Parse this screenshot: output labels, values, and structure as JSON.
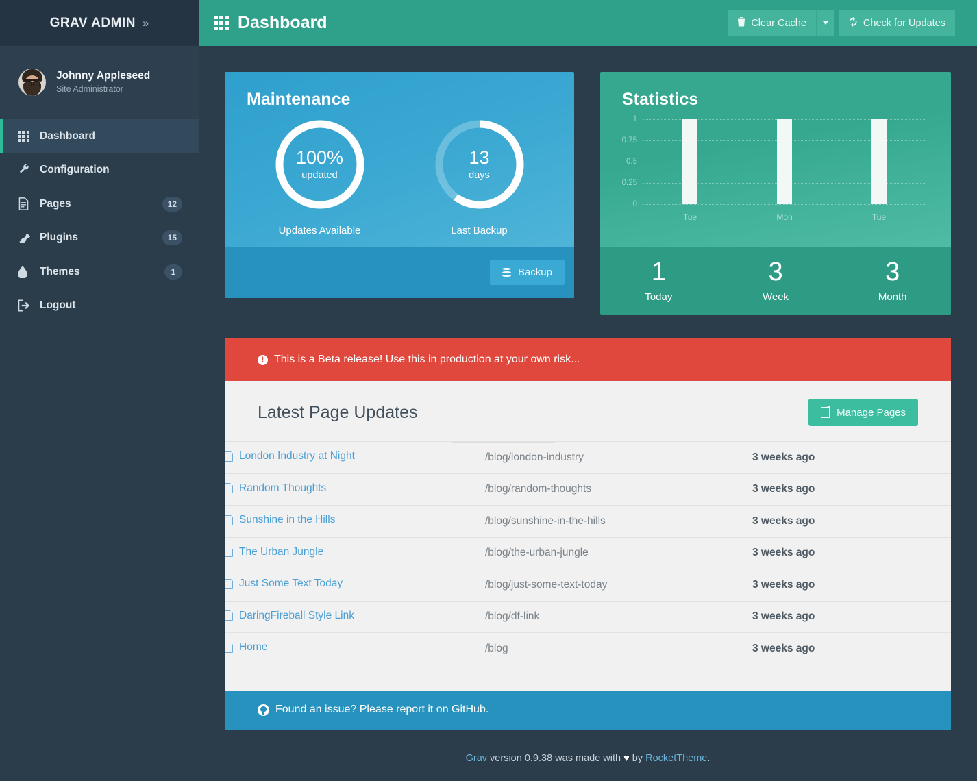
{
  "sidebar": {
    "brand": {
      "title": "GRAV ADMIN",
      "chevron": "»",
      "chevron_icon": "double-chevron-right-icon"
    },
    "user": {
      "name": "Johnny Appleseed",
      "role": "Site Administrator",
      "avatar_icon": "user-avatar"
    },
    "items": [
      {
        "label": "Dashboard",
        "icon": "grid-icon",
        "badge": "",
        "active": true
      },
      {
        "label": "Configuration",
        "icon": "wrench-icon",
        "badge": "",
        "active": false
      },
      {
        "label": "Pages",
        "icon": "page-icon",
        "badge": "12",
        "active": false
      },
      {
        "label": "Plugins",
        "icon": "plug-icon",
        "badge": "15",
        "active": false
      },
      {
        "label": "Themes",
        "icon": "droplet-icon",
        "badge": "1",
        "active": false
      },
      {
        "label": "Logout",
        "icon": "logout-icon",
        "badge": "",
        "active": false
      }
    ]
  },
  "topbar": {
    "icon": "grid-icon",
    "title": "Dashboard",
    "clear_cache_label": "Clear Cache",
    "clear_cache_icon": "trash-icon",
    "clear_cache_caret_icon": "chevron-down-icon",
    "check_updates_label": "Check for Updates",
    "check_updates_icon": "refresh-icon"
  },
  "maintenance": {
    "title": "Maintenance",
    "donuts": [
      {
        "big": "100%",
        "small": "updated",
        "label": "Updates Available",
        "percent": 100
      },
      {
        "big": "13",
        "small": "days",
        "label": "Last Backup",
        "percent": 60
      }
    ],
    "backup_label": "Backup",
    "backup_icon": "database-icon"
  },
  "statistics": {
    "title": "Statistics",
    "footer": [
      {
        "number": "1",
        "label": "Today"
      },
      {
        "number": "3",
        "label": "Week"
      },
      {
        "number": "3",
        "label": "Month"
      }
    ]
  },
  "chart_data": {
    "type": "bar",
    "title": "Statistics",
    "categories": [
      "Tue",
      "Mon",
      "Tue"
    ],
    "values": [
      1,
      1,
      1
    ],
    "xlabel": "",
    "ylabel": "",
    "ylim": [
      0,
      1
    ],
    "yticks": [
      "1",
      "0.75",
      "0.5",
      "0.25",
      "0"
    ],
    "ytick_values": [
      1,
      0.75,
      0.5,
      0.25,
      0
    ],
    "grid": true,
    "legend": "none",
    "bar_color": "#f2f8f6"
  },
  "alert": {
    "icon": "exclamation-icon",
    "exclamation": "!",
    "text": "This is a Beta release! Use this in production at your own risk..."
  },
  "updates_panel": {
    "title": "Latest Page Updates",
    "manage_label": "Manage Pages",
    "manage_icon": "page-icon",
    "rows": [
      {
        "title": "London Industry at Night",
        "path": "/blog/london-industry",
        "time": "3 weeks ago"
      },
      {
        "title": "Random Thoughts",
        "path": "/blog/random-thoughts",
        "time": "3 weeks ago"
      },
      {
        "title": "Sunshine in the Hills",
        "path": "/blog/sunshine-in-the-hills",
        "time": "3 weeks ago"
      },
      {
        "title": "The Urban Jungle",
        "path": "/blog/the-urban-jungle",
        "time": "3 weeks ago"
      },
      {
        "title": "Just Some Text Today",
        "path": "/blog/just-some-text-today",
        "time": "3 weeks ago"
      },
      {
        "title": "DaringFireball Style Link",
        "path": "/blog/df-link",
        "time": "3 weeks ago"
      },
      {
        "title": "Home",
        "path": "/blog",
        "time": "3 weeks ago"
      }
    ]
  },
  "github_bar": {
    "icon": "github-icon",
    "text": "Found an issue? Please report it on GitHub."
  },
  "footer": {
    "brand": "Grav",
    "mid": " version 0.9.38 was made with ",
    "heart": "♥",
    "by": " by ",
    "company": "RocketTheme",
    "period": "."
  },
  "colors": {
    "sidebar_bg": "#2b3c4a",
    "accent_teal": "#2dbc96",
    "topbar_green": "#2fa18a",
    "maint_blue": "#3aa8d2",
    "stats_green": "#36a890",
    "alert_red": "#e0483d",
    "github_blue": "#2792bd",
    "panel_bg": "#f1f1f1",
    "link_blue": "#4a9fd4"
  }
}
